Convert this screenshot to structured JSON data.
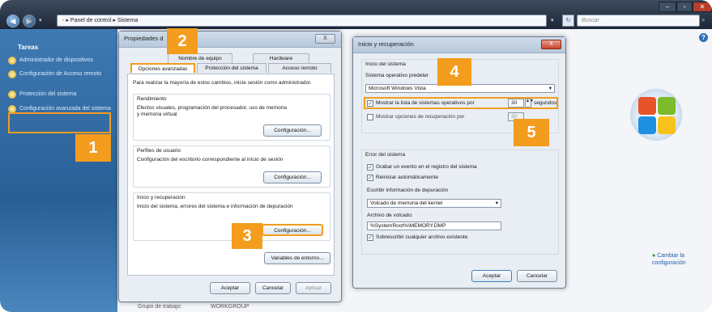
{
  "explorer": {
    "breadcrumb": [
      "Panel de control",
      "Sistema"
    ],
    "search_placeholder": "Buscar",
    "help": "?"
  },
  "taskpane": {
    "heading": "Tareas",
    "items": [
      {
        "label": "Administrador de dispositivos"
      },
      {
        "label": "Configuración de Acceso remoto"
      },
      {
        "label": "Protección del sistema"
      },
      {
        "label": "Configuración avanzada del sistema"
      }
    ]
  },
  "main": {
    "change_settings": "Cambiar la configuración"
  },
  "props_dialog": {
    "title": "Propiedades d",
    "close": "X",
    "tabs_top": [
      "Nombre de equipo",
      "Hardware"
    ],
    "tabs_bottom": [
      "Opciones avanzadas",
      "Protección del sistema",
      "Acceso remoto"
    ],
    "admin_note": "Para realizar la mayoría de estos cambios, inicie sesión como administrador.",
    "groups": [
      {
        "title": "Rendimiento",
        "text": "Efectos visuales, programación del procesador, uso de memoria y memoria virtual",
        "button": "Configuración..."
      },
      {
        "title": "Perfiles de usuario",
        "text": "Configuración del escritorio correspondiente al inicio de sesión",
        "button": "Configuración..."
      },
      {
        "title": "Inicio y recuperación",
        "text": "Inicio del sistema, errores del sistema e información de depuración",
        "button": "Configuración..."
      }
    ],
    "env_button": "Variables de entorno...",
    "ok": "Aceptar",
    "cancel": "Cancelar",
    "apply": "Aplicar"
  },
  "startup_dialog": {
    "title": "Inicio y recuperación",
    "close": "X",
    "startup_group": "Inicio del sistema",
    "default_os_label": "Sistema operativo predeter",
    "default_os_value": "Microsoft Windows Vista",
    "show_list_label": "Mostrar la lista de sistemas operativos por",
    "show_list_value": "30",
    "seconds": "segundos",
    "show_recovery_label": "Mostrar opciones de recuperación por",
    "show_recovery_value": "30",
    "failure_group": "Error del sistema",
    "write_event": "Grabar un evento en el registro del sistema",
    "auto_restart": "Reiniciar automáticamente",
    "debug_info_label": "Escribir información de depuración",
    "debug_info_value": "Volcado de memoria del kernel",
    "dump_file_label": "Archivo de volcado:",
    "dump_file_value": "%SystemRoot%\\MEMORY.DMP",
    "overwrite": "Sobrescribir cualquier archivo existente",
    "ok": "Aceptar",
    "cancel": "Cancelar"
  },
  "callouts": [
    "1",
    "2",
    "3",
    "4",
    "5"
  ],
  "bottom_text": [
    "Grupo de trabajo:",
    "WORKGROUP"
  ],
  "colors": {
    "callout": "#f39c1e",
    "taskpane": "#2a5f96",
    "link": "#1e5fa8"
  }
}
